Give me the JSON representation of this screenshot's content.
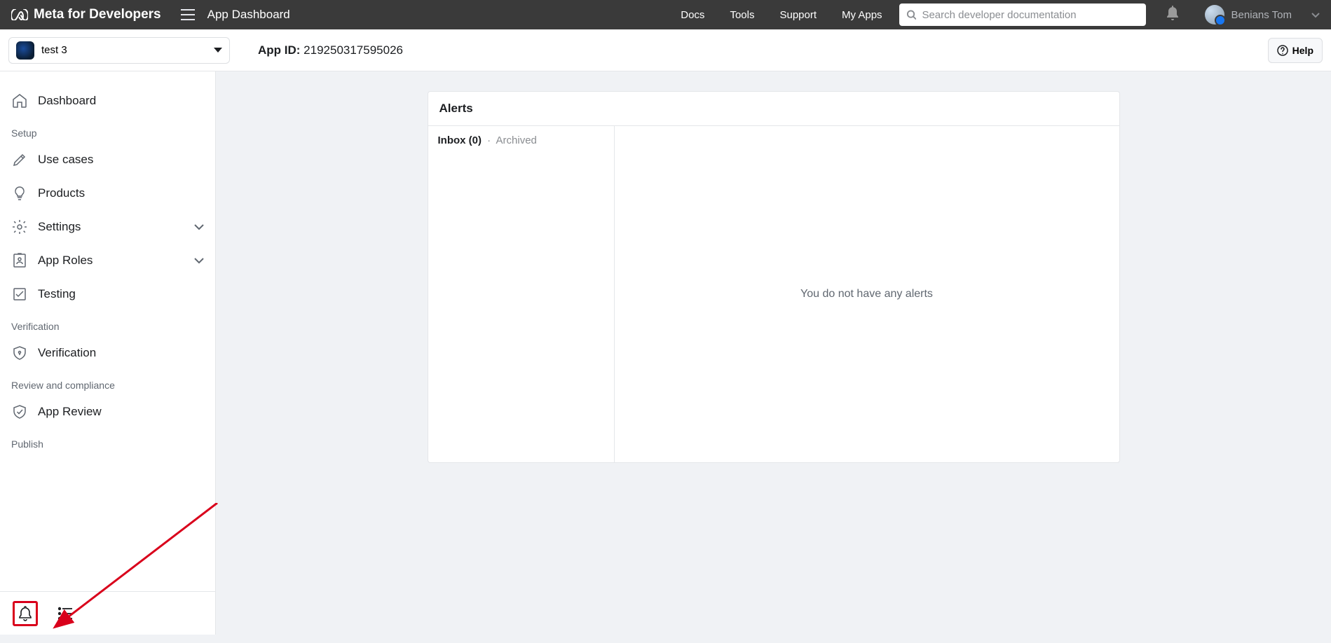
{
  "topbar": {
    "brand": "Meta for Developers",
    "dash_title": "App Dashboard",
    "nav": {
      "docs": "Docs",
      "tools": "Tools",
      "support": "Support",
      "myapps": "My Apps"
    },
    "search_placeholder": "Search developer documentation",
    "user_name": "Benians Tom"
  },
  "subheader": {
    "app_name": "test 3",
    "appid_label": "App ID:",
    "appid_value": "219250317595026",
    "help": "Help"
  },
  "sidebar": {
    "items": {
      "dashboard": "Dashboard",
      "usecases": "Use cases",
      "products": "Products",
      "settings": "Settings",
      "approles": "App Roles",
      "testing": "Testing",
      "verification": "Verification",
      "appreview": "App Review"
    },
    "sections": {
      "setup": "Setup",
      "verification": "Verification",
      "review": "Review and compliance",
      "publish": "Publish"
    }
  },
  "alerts": {
    "title": "Alerts",
    "inbox_label": "Inbox (0)",
    "archived_label": "Archived",
    "empty_message": "You do not have any alerts"
  }
}
